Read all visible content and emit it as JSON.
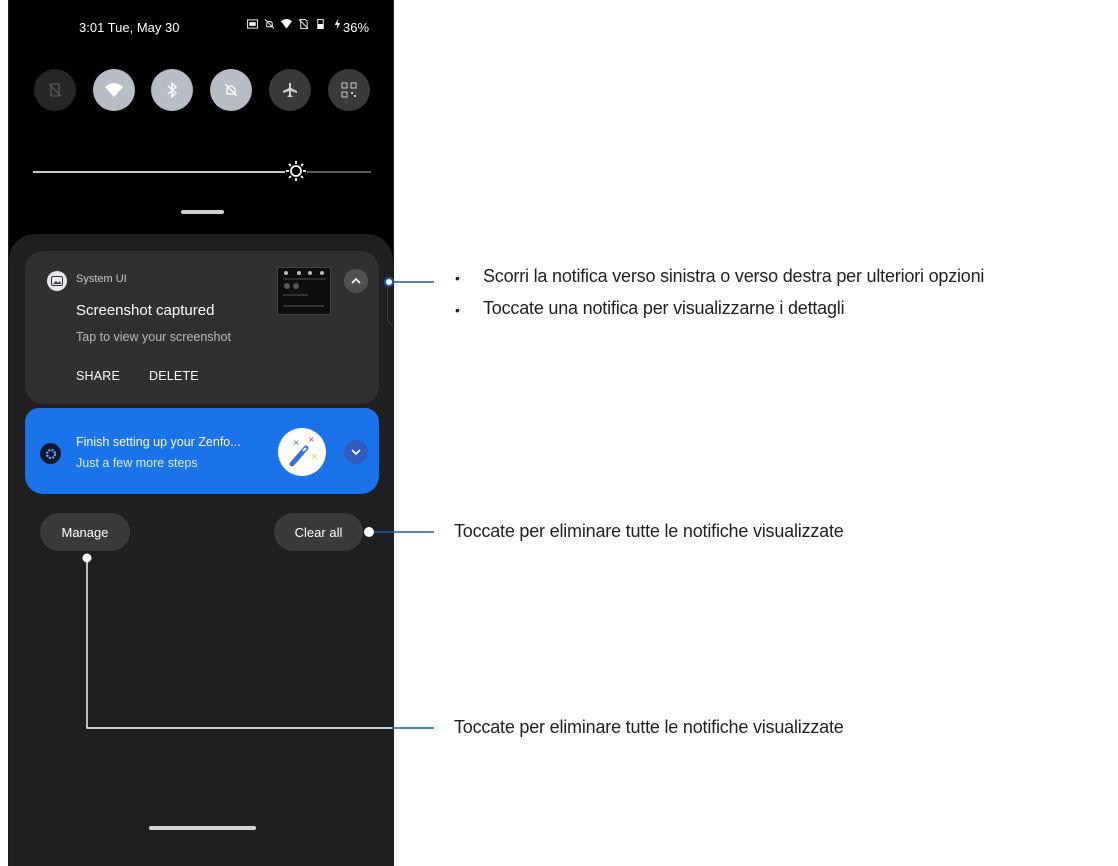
{
  "status_bar": {
    "time": "3:01 Tue, May 30",
    "battery": "36%"
  },
  "quick_settings": [
    {
      "name": "screen-rotation",
      "state": "off"
    },
    {
      "name": "wifi",
      "state": "on"
    },
    {
      "name": "bluetooth",
      "state": "on"
    },
    {
      "name": "dnd",
      "state": "on"
    },
    {
      "name": "airplane",
      "state": "off"
    },
    {
      "name": "qr-scanner",
      "state": "off"
    }
  ],
  "brightness": {
    "level": 0.75
  },
  "notifications": {
    "system": {
      "app": "System UI",
      "title": "Screenshot captured",
      "text": "Tap to view your screenshot",
      "actions": [
        "SHARE",
        "DELETE"
      ]
    },
    "setup": {
      "title": "Finish setting up your Zenfo...",
      "text": "Just a few more steps"
    }
  },
  "buttons": {
    "manage": "Manage",
    "clear_all": "Clear all"
  },
  "annotations": {
    "swipe_bullets": [
      "Scorri la notifica verso sinistra o verso destra per ulteriori opzioni",
      "Toccate una notifica per visualizzarne i dettagli"
    ],
    "clear_all": "Toccate per eliminare tutte le notifiche visualizzate",
    "manage": "Toccate per eliminare tutte le notifiche visualizzate"
  },
  "colors": {
    "accent": "#1a73e8",
    "callout_line": "#1d5aa6"
  }
}
